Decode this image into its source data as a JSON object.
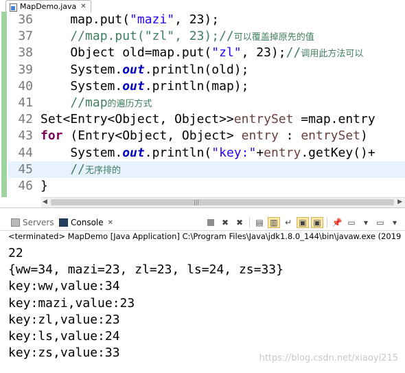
{
  "editor": {
    "tab_label": "MapDemo.java",
    "tab_icon": "java-file-icon",
    "lines": [
      {
        "num": "36",
        "parts": [
          [
            "p",
            "    map.put("
          ],
          [
            "s",
            "\"mazi\""
          ],
          [
            "p",
            ", 23);"
          ]
        ]
      },
      {
        "num": "37",
        "parts": [
          [
            "c",
            "    //map.put(\"zl\", 23);//可以覆盖掉原先的值"
          ]
        ]
      },
      {
        "num": "38",
        "parts": [
          [
            "p",
            "    Object old=map.put("
          ],
          [
            "s",
            "\"zl\""
          ],
          [
            "p",
            ", 23);"
          ],
          [
            "c",
            "//调用此方法可以"
          ]
        ]
      },
      {
        "num": "39",
        "parts": [
          [
            "p",
            "    System."
          ],
          [
            "f",
            "out"
          ],
          [
            "p",
            ".println(old);"
          ]
        ]
      },
      {
        "num": "40",
        "parts": [
          [
            "p",
            "    System."
          ],
          [
            "f",
            "out"
          ],
          [
            "p",
            ".println(map);"
          ]
        ]
      },
      {
        "num": "41",
        "parts": [
          [
            "c",
            "    //map的遍历方式"
          ]
        ]
      },
      {
        "num": "42",
        "parts": [
          [
            "p",
            "Set<Entry<Object, Object>>"
          ],
          [
            "e",
            "entrySet"
          ],
          [
            "p",
            " =map.entry"
          ]
        ]
      },
      {
        "num": "43",
        "parts": [
          [
            "k",
            "for"
          ],
          [
            "p",
            " (Entry<Object, Object> "
          ],
          [
            "e",
            "entry"
          ],
          [
            "p",
            " : "
          ],
          [
            "e",
            "entrySet"
          ],
          [
            "p",
            ")"
          ]
        ]
      },
      {
        "num": "44",
        "parts": [
          [
            "p",
            "    System."
          ],
          [
            "f",
            "out"
          ],
          [
            "p",
            ".println("
          ],
          [
            "s",
            "\"key:\""
          ],
          [
            "p",
            "+"
          ],
          [
            "e",
            "entry"
          ],
          [
            "p",
            ".getKey()+"
          ]
        ]
      },
      {
        "num": "45",
        "parts": [
          [
            "c",
            "    //无序排的"
          ]
        ]
      },
      {
        "num": "46",
        "parts": [
          [
            "p",
            "}"
          ]
        ]
      }
    ],
    "current_line": "45"
  },
  "console": {
    "tabs": {
      "servers": "Servers",
      "console": "Console"
    },
    "status": "<terminated> MapDemo [Java Application] C:\\Program Files\\Java\\jdk1.8.0_144\\bin\\javaw.exe (2019",
    "output": [
      "22",
      "{ww=34, mazi=23, zl=23, ls=24, zs=33}",
      "key:ww,value:34",
      "key:mazi,value:23",
      "key:zl,value:23",
      "key:ls,value:24",
      "key:zs,value:33"
    ],
    "toolbar": [
      "stop-icon",
      "remove-launch-icon",
      "remove-all-terminated-icon",
      "clear-console-icon",
      "scroll-lock-icon",
      "word-wrap-icon",
      "show-on-output-icon",
      "show-on-error-icon",
      "pin-console-icon",
      "display-console-icon",
      "open-console-icon",
      "view-menu-icon"
    ]
  },
  "watermark": "https://blog.csdn.net/xiaoyi215",
  "colors": {
    "keyword": "#7f0055",
    "string": "#2a00ff",
    "comment": "#3f7f5f",
    "static_field": "#0000c0",
    "field": "#0000c0"
  }
}
